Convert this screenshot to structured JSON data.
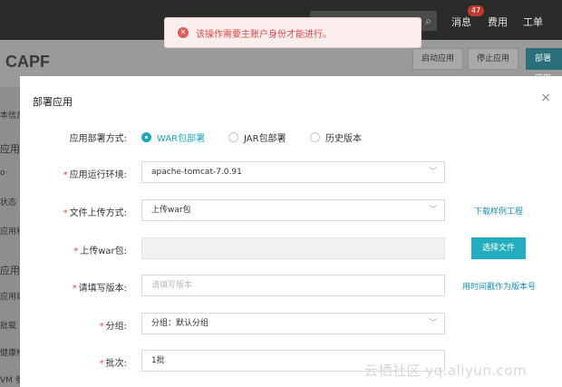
{
  "topbar": {
    "messages_label": "消息",
    "messages_count": "47",
    "billing_label": "费用",
    "ticket_label": "工单"
  },
  "page": {
    "app_title": "CAPF",
    "buttons": [
      "启动应用",
      "停止应用",
      "部署应用"
    ],
    "side_items": [
      "本信息",
      "应用信",
      "o·",
      "状态",
      "应用程",
      "应用设",
      "应用端",
      "批载",
      "健康检",
      "VM 参"
    ]
  },
  "toast": {
    "message": "该操作需要主账户身份才能进行。"
  },
  "modal": {
    "title": "部署应用",
    "deploy_method_label": "应用部署方式:",
    "deploy_options": [
      "WAR包部署",
      "JAR包部署",
      "历史版本"
    ],
    "runtime_label": "应用运行环境:",
    "runtime_value": "apache-tomcat-7.0.91",
    "upload_method_label": "文件上传方式:",
    "upload_method_value": "上传war包",
    "download_sample_link": "下载样例工程",
    "war_label": "上传war包:",
    "choose_file_button": "选择文件",
    "version_label": "请填写版本:",
    "version_placeholder": "请填写版本",
    "timestamp_link": "用时间戳作为版本号",
    "group_label": "分组:",
    "group_value": "分组：默认分组",
    "batch_label": "批次:",
    "batch_value": "1批"
  },
  "watermark": "云栖社区 yq.aliyun.com"
}
